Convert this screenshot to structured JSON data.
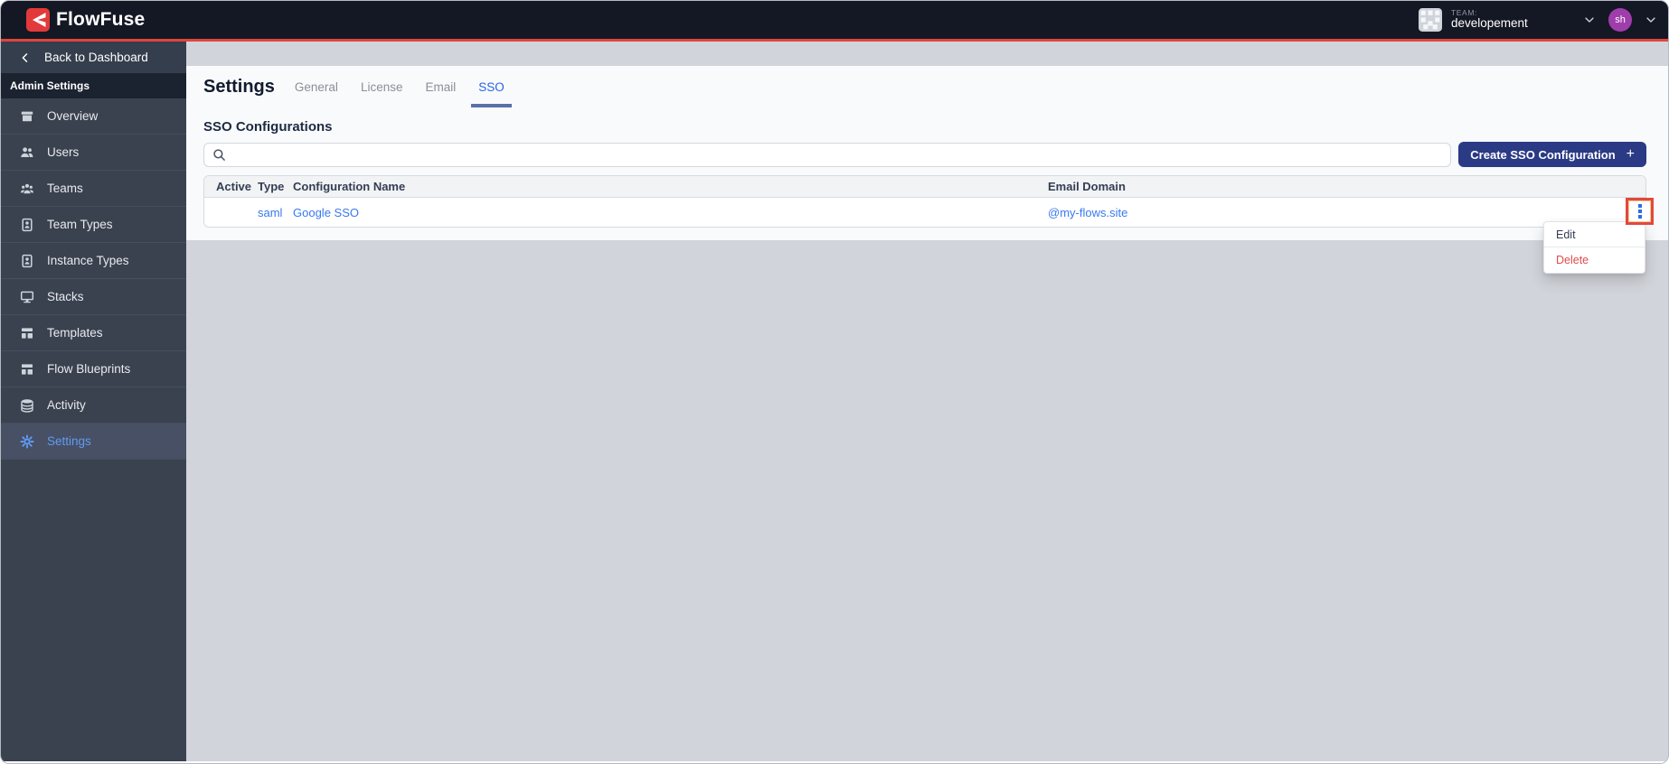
{
  "header": {
    "brand": "FlowFuse",
    "team_label": "TEAM:",
    "team_name": "developement",
    "user_initials": "sh"
  },
  "sidebar": {
    "back_label": "Back to Dashboard",
    "section_label": "Admin Settings",
    "items": [
      {
        "label": "Overview",
        "icon": "overview-icon",
        "active": false
      },
      {
        "label": "Users",
        "icon": "users-icon",
        "active": false
      },
      {
        "label": "Teams",
        "icon": "teams-icon",
        "active": false
      },
      {
        "label": "Team Types",
        "icon": "badge-icon",
        "active": false
      },
      {
        "label": "Instance Types",
        "icon": "badge-icon",
        "active": false
      },
      {
        "label": "Stacks",
        "icon": "desktop-icon",
        "active": false
      },
      {
        "label": "Templates",
        "icon": "template-icon",
        "active": false
      },
      {
        "label": "Flow Blueprints",
        "icon": "template-icon",
        "active": false
      },
      {
        "label": "Activity",
        "icon": "database-icon",
        "active": false
      },
      {
        "label": "Settings",
        "icon": "gear-icon",
        "active": true
      }
    ]
  },
  "main": {
    "title": "Settings",
    "tabs": [
      {
        "label": "General",
        "active": false
      },
      {
        "label": "License",
        "active": false
      },
      {
        "label": "Email",
        "active": false
      },
      {
        "label": "SSO",
        "active": true
      }
    ],
    "section_title": "SSO Configurations",
    "search": {
      "value": "",
      "placeholder": ""
    },
    "create_button": "Create SSO Configuration",
    "plus_icon": "+",
    "table": {
      "columns": [
        "Active",
        "Type",
        "Configuration Name",
        "Email Domain"
      ],
      "row": {
        "active": "",
        "type": "saml",
        "name": "Google SSO",
        "email": "@my-flows.site"
      }
    },
    "menu": {
      "edit": "Edit",
      "delete": "Delete"
    }
  },
  "colors": {
    "brand_red": "#e0453c",
    "header_bg": "#141824",
    "sidebar_bg": "#3a4250",
    "active_link_blue": "#619bf2",
    "tab_active_blue": "#2563eb",
    "button_navy": "#2b3a85",
    "link_blue": "#3779f0",
    "delete_red": "#e14b4b",
    "highlight_red": "#e2483d",
    "content_gray": "#d2d4db"
  }
}
